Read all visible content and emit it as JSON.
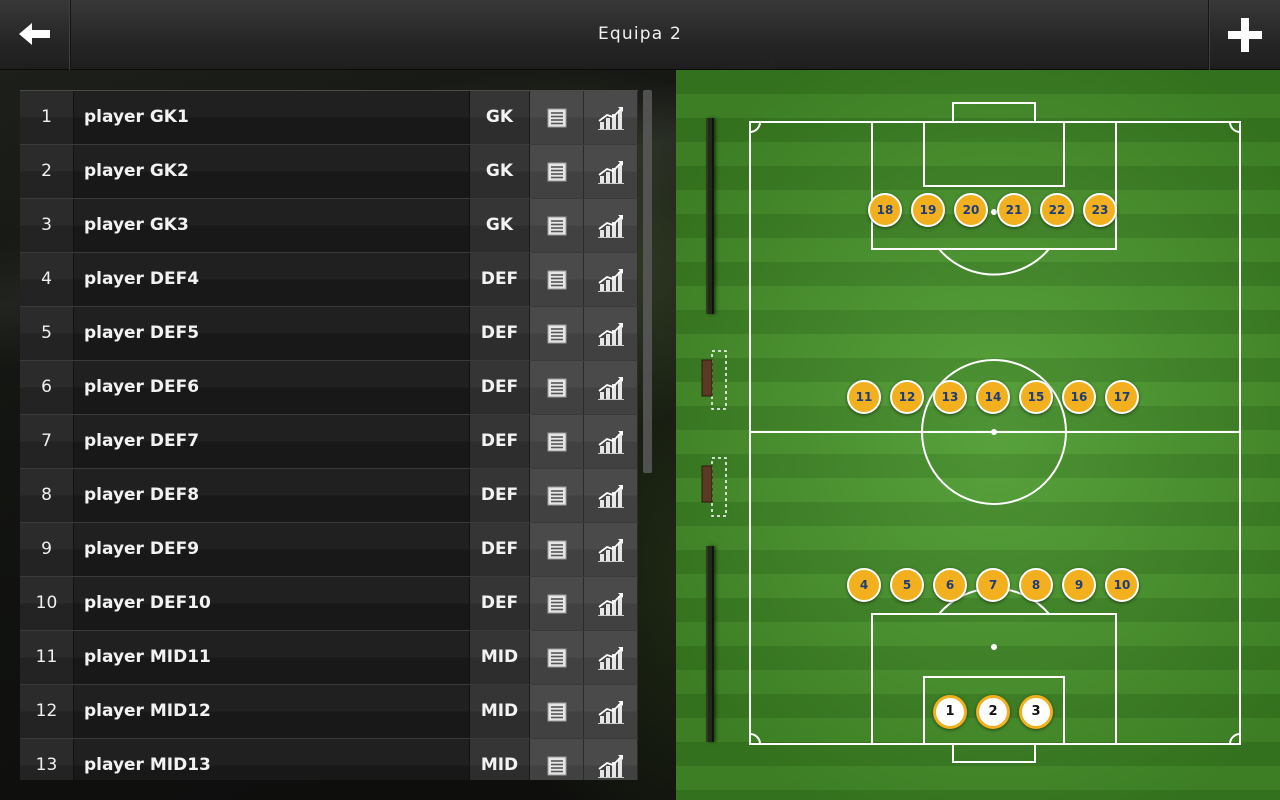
{
  "header": {
    "title": "Equipa 2",
    "back_icon": "arrow-left-icon",
    "add_icon": "plus-icon"
  },
  "players": [
    {
      "number": "1",
      "name": "player GK1",
      "position": "GK"
    },
    {
      "number": "2",
      "name": "player GK2",
      "position": "GK"
    },
    {
      "number": "3",
      "name": "player GK3",
      "position": "GK"
    },
    {
      "number": "4",
      "name": "player DEF4",
      "position": "DEF"
    },
    {
      "number": "5",
      "name": "player DEF5",
      "position": "DEF"
    },
    {
      "number": "6",
      "name": "player DEF6",
      "position": "DEF"
    },
    {
      "number": "7",
      "name": "player DEF7",
      "position": "DEF"
    },
    {
      "number": "8",
      "name": "player DEF8",
      "position": "DEF"
    },
    {
      "number": "9",
      "name": "player DEF9",
      "position": "DEF"
    },
    {
      "number": "10",
      "name": "player DEF10",
      "position": "DEF"
    },
    {
      "number": "11",
      "name": "player MID11",
      "position": "MID"
    },
    {
      "number": "12",
      "name": "player MID12",
      "position": "MID"
    },
    {
      "number": "13",
      "name": "player MID13",
      "position": "MID"
    }
  ],
  "row_icons": {
    "details": "list-icon",
    "stats": "stats-chart-icon"
  },
  "pitch": {
    "forwards": [
      "18",
      "19",
      "20",
      "21",
      "22",
      "23"
    ],
    "midfielders": [
      "11",
      "12",
      "13",
      "14",
      "15",
      "16",
      "17"
    ],
    "defenders": [
      "4",
      "5",
      "6",
      "7",
      "8",
      "9",
      "10"
    ],
    "goalkeepers": [
      "1",
      "2",
      "3"
    ]
  },
  "colors": {
    "token_fill": "#f2b01e",
    "token_text": "#1d3c7a",
    "goalkeeper_fill": "#ffffff",
    "pitch_light": "#4a9a2c",
    "pitch_dark": "#3f8a24"
  }
}
